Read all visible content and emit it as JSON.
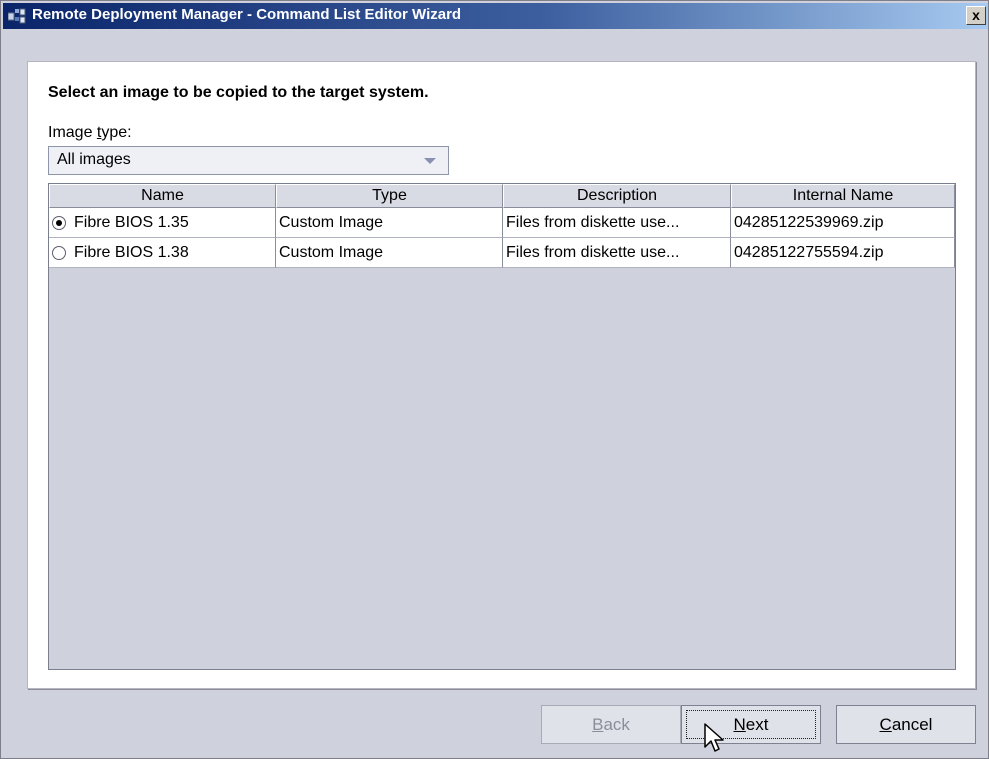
{
  "window": {
    "title": "Remote Deployment Manager - Command List Editor Wizard",
    "close_label": "x"
  },
  "instruction": "Select an image to be copied to the target system.",
  "image_type": {
    "label_before": "Image ",
    "label_mnemonic": "t",
    "label_after": "ype:",
    "selected": "All images"
  },
  "table": {
    "columns": [
      "Name",
      "Type",
      "Description",
      "Internal Name"
    ],
    "rows": [
      {
        "selected": true,
        "name": "Fibre BIOS 1.35",
        "type": "Custom Image",
        "description": "Files from diskette use...",
        "internal_name": "04285122539969.zip"
      },
      {
        "selected": false,
        "name": "Fibre BIOS 1.38",
        "type": "Custom Image",
        "description": "Files from diskette use...",
        "internal_name": "04285122755594.zip"
      }
    ]
  },
  "buttons": {
    "back": {
      "mnemonic": "B",
      "rest": "ack",
      "enabled": false
    },
    "next": {
      "mnemonic": "N",
      "rest": "ext",
      "focused": true
    },
    "cancel": {
      "mnemonic": "C",
      "rest": "ancel"
    }
  },
  "icons": {
    "app": "rdm-app-icon",
    "close": "close-icon",
    "dropdown": "chevron-down-icon",
    "cursor": "mouse-pointer-icon"
  }
}
